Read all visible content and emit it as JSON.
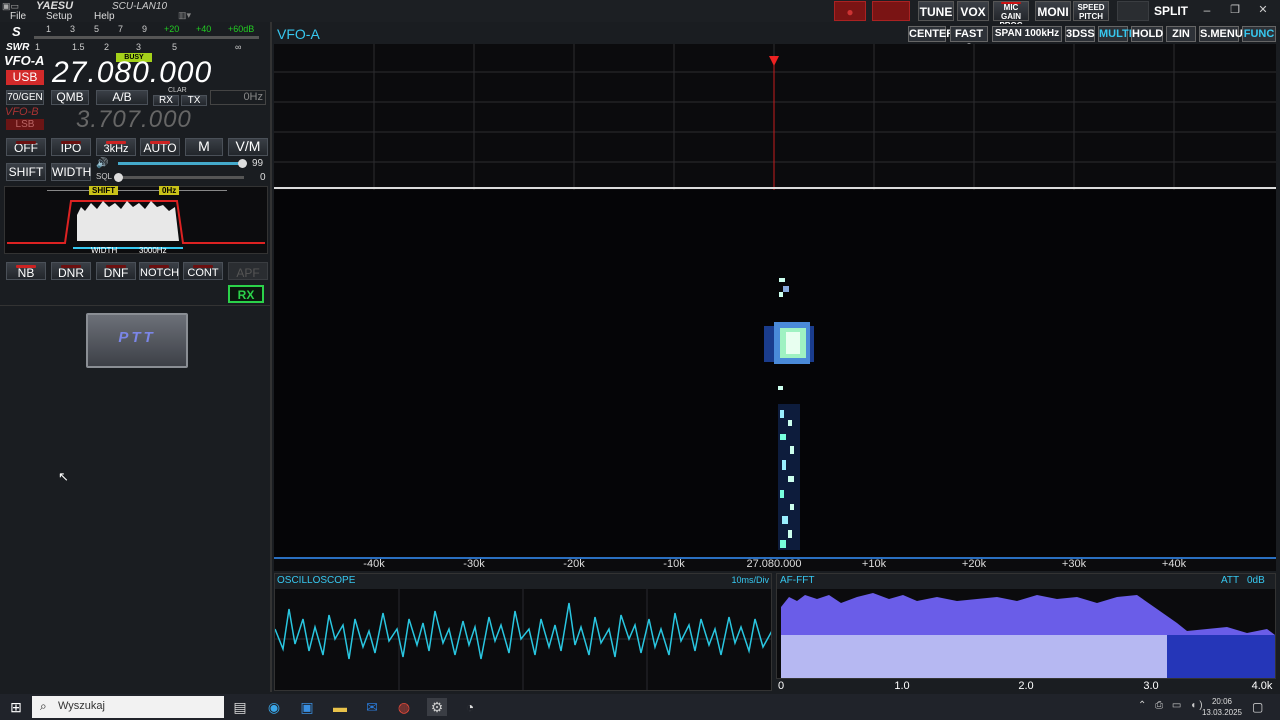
{
  "app": {
    "brand": "YAESU",
    "model": "SCU-LAN10",
    "menu": [
      "File",
      "Setup",
      "Help"
    ]
  },
  "toolbar": {
    "buttons": [
      "TUNE",
      "VOX",
      "MIC GAIN PROC",
      "MONI",
      "SPEED PITCH",
      "SPLIT"
    ],
    "mic_gain_top": "MIC GAIN",
    "mic_gain_bottom": "PROC",
    "speed_pitch_top": "SPEED",
    "speed_pitch_bottom": "PITCH"
  },
  "window_controls": {
    "minimize": "–",
    "restore": "❐",
    "close": "✕"
  },
  "meter": {
    "s_label": "S",
    "swr_label": "SWR",
    "s_scale": [
      "1",
      "3",
      "5",
      "7",
      "9",
      "+20",
      "+40",
      "+60dB"
    ],
    "swr_scale": [
      "1",
      "1.5",
      "2",
      "3",
      "5",
      "∞"
    ]
  },
  "vfo_a": {
    "label": "VFO-A",
    "mode": "USB",
    "busy": "BUSY",
    "frequency": "27.080.000"
  },
  "vfo_b": {
    "label": "VFO-B",
    "mode": "LSB",
    "frequency": "3.707.000"
  },
  "row_buttons": {
    "gen": "70/GEN",
    "qmb": "QMB",
    "ab": "A/B",
    "clar": "CLAR",
    "rx": "RX",
    "tx": "TX",
    "offset": "0Hz"
  },
  "controls": {
    "off": "OFF",
    "ipo": "IPO",
    "bw": "3kHz",
    "auto": "AUTO",
    "m": "M",
    "vm": "V/M",
    "shift": "SHIFT",
    "width": "WIDTH",
    "af_value": "99",
    "sql_label": "SQL",
    "sql_value": "0"
  },
  "filter": {
    "shift_label": "SHIFT",
    "shift_value": "0Hz",
    "width_label": "WIDTH",
    "width_value": "3000Hz"
  },
  "dsp_buttons": [
    "NB",
    "DNR",
    "DNF",
    "NOTCH",
    "CONT",
    "APF"
  ],
  "rx_badge": "RX",
  "ptt": "PTT",
  "scope": {
    "vfo_label": "VFO-A",
    "options": [
      "CENTER",
      "FAST 3",
      "SPAN 100kHz",
      "3DSS",
      "MULTI",
      "HOLD",
      "ZIN",
      "S.MENU",
      "FUNC"
    ],
    "center_freq": "27.080.000",
    "ticks": [
      "-40k",
      "-30k",
      "-20k",
      "-10k",
      "27.080.000",
      "+10k",
      "+20k",
      "+30k",
      "+40k"
    ]
  },
  "oscilloscope": {
    "title": "OSCILLOSCOPE",
    "rate": "10ms/Div"
  },
  "af_fft": {
    "title": "AF-FFT",
    "att": "ATT",
    "att_value": "0dB",
    "axis": [
      "0",
      "1.0",
      "2.0",
      "3.0",
      "4.0k"
    ]
  },
  "taskbar": {
    "search_placeholder": "Wyszukaj",
    "time": "20:06",
    "date": "13.03.2025"
  },
  "colors": {
    "panel": "#1a1d21",
    "scope_bg": "#0b0b0d",
    "trace": "#29c6e0",
    "fft_blue": "#6a5de8",
    "freq_white": "#ffffff",
    "mode_red": "#d22a2a",
    "rx_green": "#2bd24a",
    "accent_cyan": "#37c8f0"
  }
}
